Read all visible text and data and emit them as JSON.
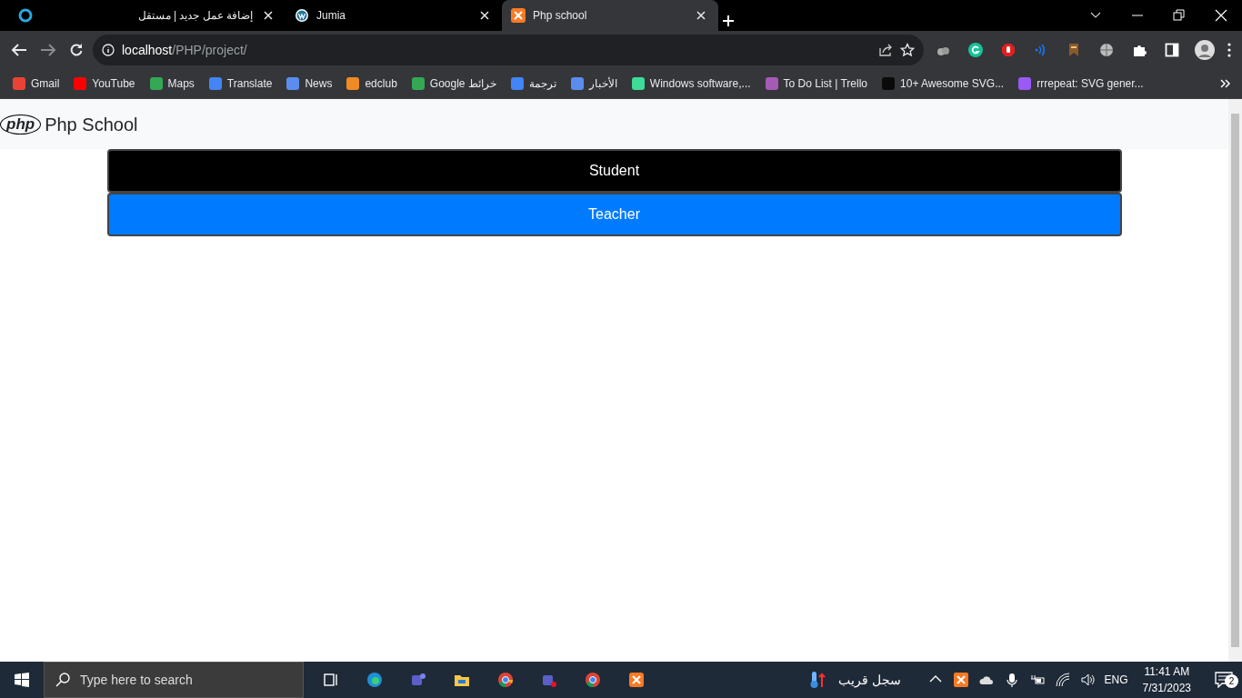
{
  "tabs": [
    {
      "title": "إضافة عمل جديد | مستقل",
      "kind": "ring",
      "selected": false
    },
    {
      "title": "Jumia",
      "kind": "wp",
      "selected": false
    },
    {
      "title": "Php school",
      "kind": "xampp",
      "selected": true
    }
  ],
  "address": {
    "host": "localhost",
    "path": "/PHP/project/"
  },
  "bookmarks": [
    {
      "label": "Gmail",
      "color": "#ea4335"
    },
    {
      "label": "YouTube",
      "color": "#ff0000"
    },
    {
      "label": "Maps",
      "color": "#34a853"
    },
    {
      "label": "Translate",
      "color": "#4285f4"
    },
    {
      "label": "News",
      "color": "#5b8def"
    },
    {
      "label": "edclub",
      "color": "#f08a24"
    },
    {
      "label": "Google خرائط",
      "color": "#34a853"
    },
    {
      "label": "ترجمة",
      "color": "#4285f4"
    },
    {
      "label": "الأخبار",
      "color": "#5b8def"
    },
    {
      "label": "Windows software,...",
      "color": "#3ddc97"
    },
    {
      "label": "To Do List | Trello",
      "color": "#a35bb5"
    },
    {
      "label": "10+ Awesome SVG...",
      "color": "#0a0a0a"
    },
    {
      "label": "rrrepeat: SVG gener...",
      "color": "#9b59f5"
    }
  ],
  "page": {
    "logo": "php",
    "brand": "Php School",
    "buttons": [
      {
        "label": "Student",
        "kind": "dark"
      },
      {
        "label": "Teacher",
        "kind": "primary"
      }
    ]
  },
  "taskbar": {
    "search_placeholder": "Type here to search",
    "weather": "سجل قريب",
    "language": "ENG",
    "time": "11:41 AM",
    "date": "7/31/2023",
    "notifications": "2"
  }
}
